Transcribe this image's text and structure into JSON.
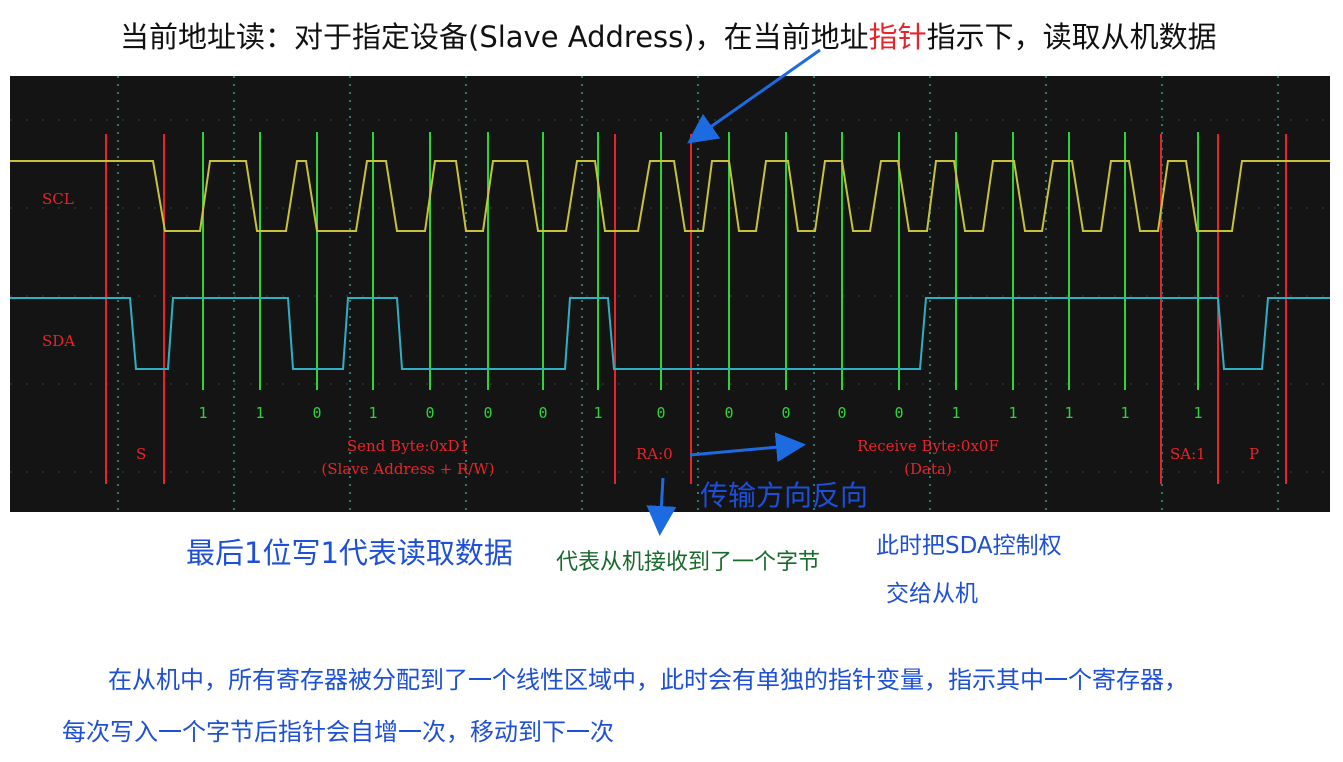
{
  "title": {
    "prefix": "当前地址读：对于指定设备(Slave Address)，在当前地址",
    "highlight": "指针",
    "suffix": "指示下，读取从机数据"
  },
  "scope": {
    "scl_label": "SCL",
    "sda_label": "SDA",
    "bits": [
      "1",
      "1",
      "0",
      "1",
      "0",
      "0",
      "0",
      "1",
      "0",
      "0",
      "0",
      "0",
      "0",
      "1",
      "1",
      "1",
      "1",
      "1"
    ],
    "segments": {
      "start": "S",
      "send_byte": "Send Byte:0xD1",
      "send_byte_sub": "(Slave Address + R/W)",
      "receiver_ack": "RA:0",
      "receive_byte": "Receive Byte:0x0F",
      "receive_byte_sub": "(Data)",
      "sender_ack": "SA:1",
      "stop": "P"
    },
    "colors": {
      "background": "#141414",
      "scl": "#c8c23a",
      "sda": "#2fb0c2",
      "bit_marker": "#2bd43a",
      "boundary": "#e8242b",
      "label": "#e8242b",
      "bit_text": "#2bd43a"
    }
  },
  "annotations": {
    "direction": "传输方向反向",
    "last_bit": "最后1位写1代表读取数据",
    "ack_meaning": "代表从机接收到了一个字节",
    "control_line1": "此时把SDA控制权",
    "control_line2": "交给从机",
    "paragraph_line1": "在从机中，所有寄存器被分配到了一个线性区域中，此时会有单独的指针变量，指示其中一个寄存器，",
    "paragraph_line2": "每次写入一个字节后指针会自增一次，移动到下一次"
  }
}
